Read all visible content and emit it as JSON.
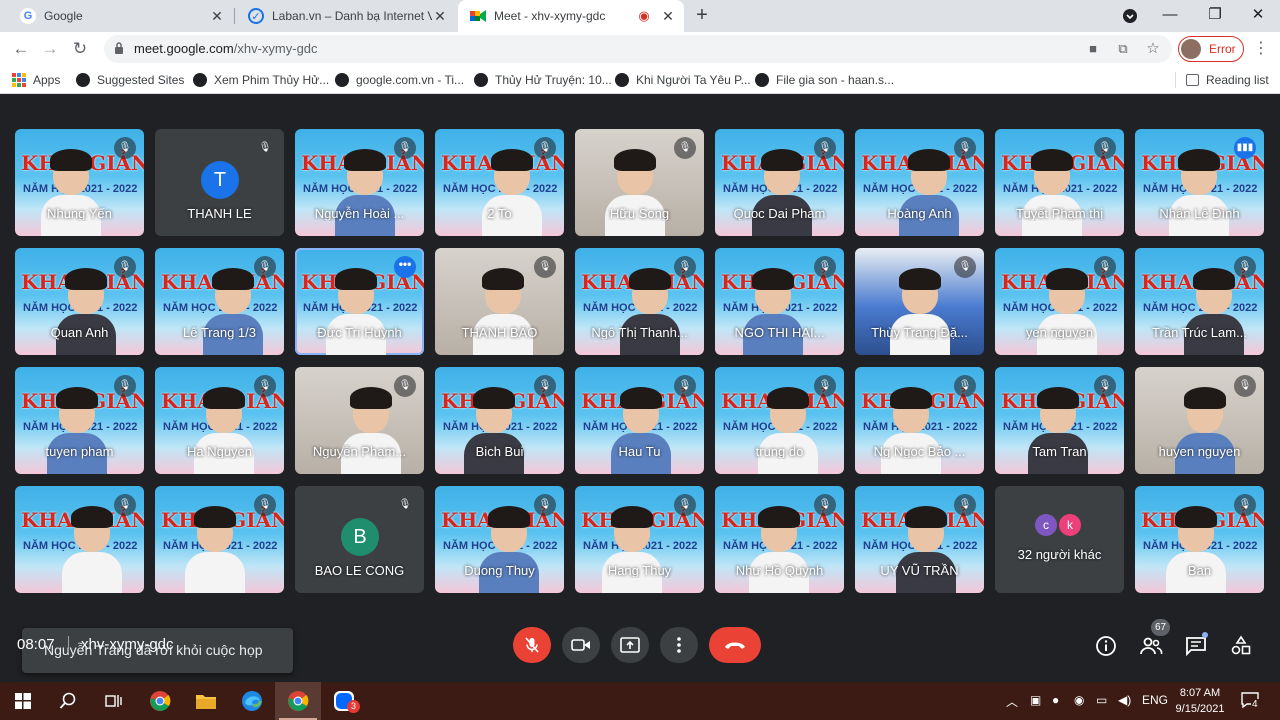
{
  "browser": {
    "tabs": [
      {
        "title": "Google",
        "favicon": "google-icon"
      },
      {
        "title": "Laban.vn – Danh bạ Internet Việt",
        "favicon": "laban-icon"
      },
      {
        "title": "Meet - xhv-xymy-gdc",
        "favicon": "meet-icon"
      }
    ],
    "url_host": "meet.google.com",
    "url_path": "/xhv-xymy-gdc",
    "profile_label": "Error",
    "bookmarks": [
      "Apps",
      "Suggested Sites",
      "Xem Phim Thủy Hử...",
      "google.com.vn - Ti...",
      "Thủy Hử Truyện: 10...",
      "Khi Người Ta Yêu P...",
      "File gia son - haan.s..."
    ],
    "reading_list": "Reading list"
  },
  "meet": {
    "tiles": [
      {
        "name": "Nhung Yến",
        "kind": "banner"
      },
      {
        "name": "THANH LE",
        "kind": "letter",
        "letter": "T",
        "color": "#1a73e8"
      },
      {
        "name": "Nguyễn Hoài ...",
        "kind": "banner"
      },
      {
        "name": "2 To",
        "kind": "banner"
      },
      {
        "name": "Hữu Song",
        "kind": "room"
      },
      {
        "name": "Quoc Dai Pham",
        "kind": "banner"
      },
      {
        "name": "Hoàng Anh",
        "kind": "banner"
      },
      {
        "name": "Tuyết Phạm thị",
        "kind": "banner"
      },
      {
        "name": "Nhân Lê Đình",
        "kind": "banner"
      },
      {
        "name": "Quan Anh",
        "kind": "banner"
      },
      {
        "name": "Lê Trang 1/3",
        "kind": "banner"
      },
      {
        "name": "Đức Trí Huỳnh",
        "kind": "banner"
      },
      {
        "name": "THÀNH BẢO",
        "kind": "room"
      },
      {
        "name": "Ngô Thị Thanh...",
        "kind": "banner"
      },
      {
        "name": "NGO THI HAI...",
        "kind": "banner"
      },
      {
        "name": "Thùy Trang Đặ...",
        "kind": "hall"
      },
      {
        "name": "yen nguyen",
        "kind": "banner"
      },
      {
        "name": "Trần Trúc Lam...",
        "kind": "banner"
      },
      {
        "name": "tuyen pham",
        "kind": "banner"
      },
      {
        "name": "Ha Nguyen",
        "kind": "banner"
      },
      {
        "name": "Nguyễn Phạm...",
        "kind": "room"
      },
      {
        "name": "Bich Bui",
        "kind": "banner"
      },
      {
        "name": "Hau Tu",
        "kind": "banner"
      },
      {
        "name": "trung do",
        "kind": "banner"
      },
      {
        "name": "Ng Ngọc Bảo ...",
        "kind": "banner"
      },
      {
        "name": "Tam Tran",
        "kind": "banner"
      },
      {
        "name": "huyen nguyen",
        "kind": "room"
      },
      {
        "name": "",
        "kind": "banner"
      },
      {
        "name": "",
        "kind": "banner"
      },
      {
        "name": "BAO LE CONG",
        "kind": "letter",
        "letter": "B",
        "color": "#1e8e6e"
      },
      {
        "name": "Duong Thuy",
        "kind": "banner"
      },
      {
        "name": "Hang Thuy",
        "kind": "banner"
      },
      {
        "name": "Như Hồ Quỳnh",
        "kind": "banner"
      },
      {
        "name": "UY VŨ TRẦN",
        "kind": "banner"
      },
      {
        "name": "32 người khác",
        "kind": "others"
      },
      {
        "name": "Ban",
        "kind": "banner"
      }
    ],
    "banner_text": "KHAI GIẢNG",
    "banner_year": "NĂM HỌC 2021 - 2022",
    "others_letters": [
      "c",
      "k"
    ],
    "others_colors": [
      "#7e57c2",
      "#ec407a"
    ],
    "toast": "Nguyễn Trang đã rời khỏi cuộc họp",
    "time": "08:07",
    "meeting_code": "xhv-xymy-gdc",
    "participants_count": "67",
    "accent_red": "#ea4335"
  },
  "taskbar": {
    "lang": "ENG",
    "time": "8:07 AM",
    "date": "9/15/2021",
    "notification_count": "4",
    "zalo_badge": "3"
  }
}
